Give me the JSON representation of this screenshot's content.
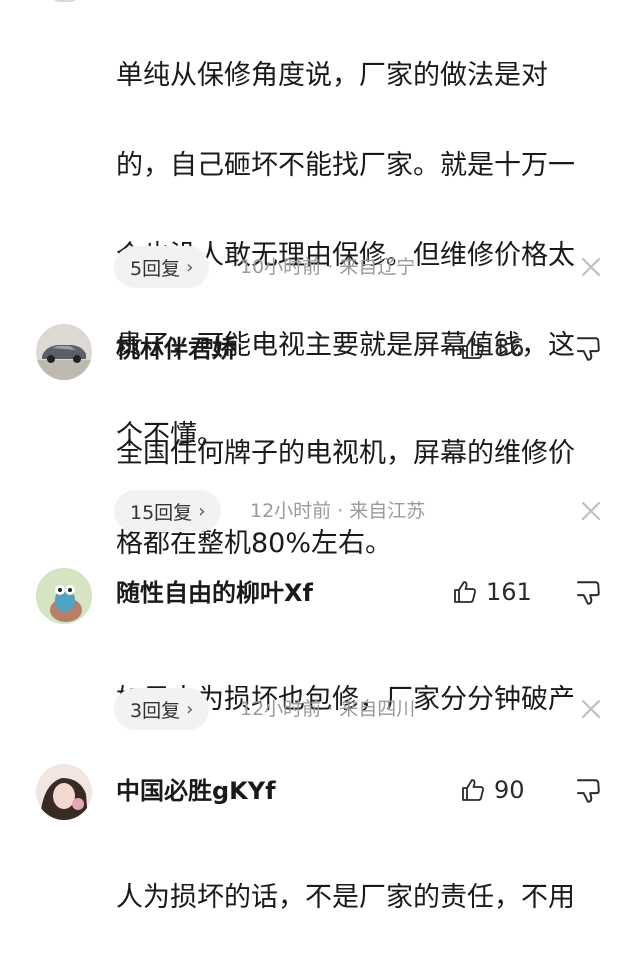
{
  "comments": [
    {
      "text": "单纯从保修角度说，厂家的做法是对的，自己砸坏不能找厂家。就是十万一个也没人敢无理由保修。但维修价格太贵了，可能电视主要就是屏幕值钱，这个不懂。",
      "lines": [
        "单纯从保修角度说，厂家的做法是对",
        "的，自己砸坏不能找厂家。就是十万一",
        "个也没人敢无理由保修。但维修价格太",
        "贵了，可能电视主要就是屏幕值钱，这",
        "个不懂。"
      ],
      "replies_label": "5回复",
      "meta": "10小时前 · 来自辽宁"
    },
    {
      "username": "桃林伴君娇",
      "likes": "86",
      "lines": [
        "全国任何牌子的电视机，屏幕的维修价",
        "格都在整机80%左右。"
      ],
      "replies_label": "15回复",
      "meta": "12小时前 · 来自江苏"
    },
    {
      "username": "随性自由的柳叶Xf",
      "likes": "161",
      "lines": [
        "如果人为损坏也包修，厂家分分钟破产"
      ],
      "replies_label": "3回复",
      "meta": "12小时前 · 来自四川"
    },
    {
      "username": "中国必胜gKYf",
      "likes": "90",
      "lines": [
        "人为损坏的话，不是厂家的责任，不用"
      ]
    }
  ],
  "icons": {
    "like": "thumbs-up-outline-icon",
    "dislike": "thumbs-down-outline-icon",
    "close": "close-x-icon",
    "chevron": "chevron-right-icon"
  },
  "chevron_glyph": "›",
  "colors": {
    "text": "#1a1a1a",
    "meta": "#9a9a9a",
    "pill_bg": "#f2f2f2",
    "icon_gray": "#bdbdbd"
  }
}
